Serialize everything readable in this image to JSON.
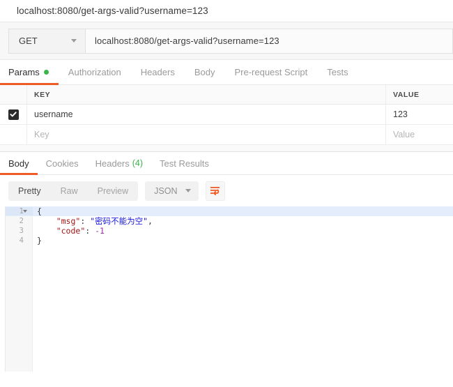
{
  "window": {
    "title": "localhost:8080/get-args-valid?username=123"
  },
  "request": {
    "method": "GET",
    "method_icon": "chevron-down-icon",
    "url": "localhost:8080/get-args-valid?username=123",
    "tabs": [
      {
        "label": "Params",
        "active": true,
        "indicator": "green-dot"
      },
      {
        "label": "Authorization",
        "active": false
      },
      {
        "label": "Headers",
        "active": false
      },
      {
        "label": "Body",
        "active": false
      },
      {
        "label": "Pre-request Script",
        "active": false
      },
      {
        "label": "Tests",
        "active": false
      }
    ]
  },
  "params": {
    "columns": {
      "key": "KEY",
      "value": "VALUE"
    },
    "rows": [
      {
        "checked": true,
        "key": "username",
        "value": "123"
      }
    ],
    "empty_row": {
      "key_placeholder": "Key",
      "value_placeholder": "Value"
    }
  },
  "response": {
    "tabs": [
      {
        "label": "Body",
        "active": true
      },
      {
        "label": "Cookies",
        "active": false
      },
      {
        "label": "Headers",
        "active": false,
        "count": "(4)"
      },
      {
        "label": "Test Results",
        "active": false
      }
    ],
    "view_modes": [
      {
        "label": "Pretty",
        "active": true
      },
      {
        "label": "Raw",
        "active": false
      },
      {
        "label": "Preview",
        "active": false
      }
    ],
    "format": "JSON",
    "format_icon": "chevron-down-icon",
    "wrap_button_icon": "wrap-text-icon",
    "body": {
      "lines": [
        {
          "number": "1",
          "foldable": true,
          "highlighted": true,
          "tokens": [
            {
              "text": "{",
              "type": "punc"
            }
          ]
        },
        {
          "number": "2",
          "foldable": false,
          "highlighted": false,
          "tokens": [
            {
              "text": "    ",
              "type": "punc"
            },
            {
              "text": "\"msg\"",
              "type": "key"
            },
            {
              "text": ": ",
              "type": "punc"
            },
            {
              "text": "\"密码不能为空\"",
              "type": "str"
            },
            {
              "text": ",",
              "type": "punc"
            }
          ]
        },
        {
          "number": "3",
          "foldable": false,
          "highlighted": false,
          "tokens": [
            {
              "text": "    ",
              "type": "punc"
            },
            {
              "text": "\"code\"",
              "type": "key"
            },
            {
              "text": ": ",
              "type": "punc"
            },
            {
              "text": "-1",
              "type": "num"
            }
          ]
        },
        {
          "number": "4",
          "foldable": false,
          "highlighted": false,
          "tokens": [
            {
              "text": "}",
              "type": "punc"
            }
          ]
        }
      ]
    }
  },
  "colors": {
    "accent_orange": "#ef5b25",
    "indicator_green": "#39b54a",
    "json_key": "#a31515",
    "json_string": "#1515e0",
    "json_number": "#9b2ea8",
    "line_highlight": "#e4edfb"
  }
}
